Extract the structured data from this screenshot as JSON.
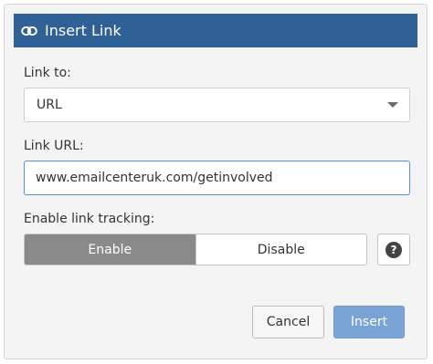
{
  "dialog": {
    "title": "Insert Link",
    "title_icon": "link-icon"
  },
  "link_to": {
    "label": "Link to:",
    "selected": "URL"
  },
  "link_url": {
    "label": "Link URL:",
    "value": "www.emailcenteruk.com/getinvolved"
  },
  "tracking": {
    "label": "Enable link tracking:",
    "options": [
      "Enable",
      "Disable"
    ],
    "selected": "Enable",
    "help_icon": "question-mark-icon"
  },
  "actions": {
    "cancel_label": "Cancel",
    "insert_label": "Insert"
  },
  "colors": {
    "header": "#2f6196",
    "primary_button": "#7aa4d6",
    "active_toggle": "#8a8a8a"
  }
}
